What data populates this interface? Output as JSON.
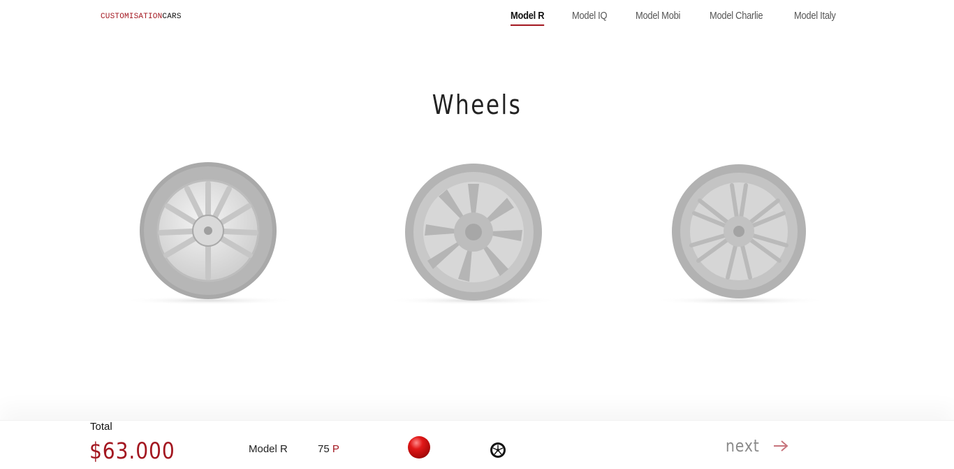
{
  "brand": {
    "part1": "CUSTOMISATION",
    "part2": "CARS"
  },
  "nav": {
    "items": [
      {
        "label": "Model R",
        "active": true
      },
      {
        "label": "Model IQ",
        "active": false
      },
      {
        "label": "Model Mobi",
        "active": false
      },
      {
        "label": "Model Charlie",
        "active": false
      },
      {
        "label": "Model Italy",
        "active": false
      }
    ]
  },
  "section": {
    "title": "Wheels"
  },
  "wheels": [
    {
      "style": "twin-spoke-silver",
      "selected": false
    },
    {
      "style": "turbine-grey",
      "selected": false
    },
    {
      "style": "split-spoke-grey",
      "selected": false
    }
  ],
  "footer": {
    "total_label": "Total",
    "total_value": "$63.000",
    "model": "Model R",
    "battery": "75",
    "battery_unit": "P",
    "color": "#d11414",
    "wheel_icon": "wheel-icon",
    "next_label": "next"
  },
  "colors": {
    "accent": "#a31720",
    "text": "#222222",
    "muted": "#8a8a8a"
  }
}
